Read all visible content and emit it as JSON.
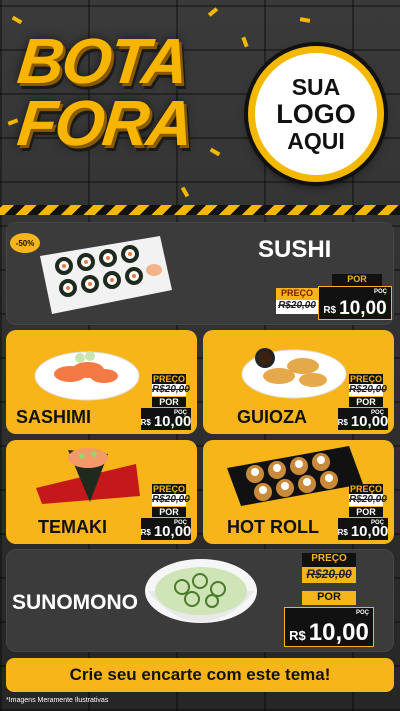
{
  "header": {
    "title_line_1": "BOTA",
    "title_line_2": "FORA",
    "logo_line_1": "SUA",
    "logo_line_2": "LOGO",
    "logo_line_3": "AQUI"
  },
  "products": [
    {
      "name": "SUSHI",
      "discount": "-50%",
      "preco_label": "PREÇO",
      "old_price": "R$20,00",
      "por_label": "POR",
      "currency": "R$",
      "price": "10,00",
      "unit": "POÇ"
    },
    {
      "name": "SASHIMI",
      "preco_label": "PREÇO",
      "old_price": "R$20,00",
      "por_label": "POR",
      "currency": "R$",
      "price": "10,00",
      "unit": "POÇ"
    },
    {
      "name": "GUIOZA",
      "preco_label": "PREÇO",
      "old_price": "R$20,00",
      "por_label": "POR",
      "currency": "R$",
      "price": "10,00",
      "unit": "POÇ"
    },
    {
      "name": "TEMAKI",
      "preco_label": "PREÇO",
      "old_price": "R$20,00",
      "por_label": "POR",
      "currency": "R$",
      "price": "10,00",
      "unit": "POÇ"
    },
    {
      "name": "HOT ROLL",
      "preco_label": "PREÇO",
      "old_price": "R$20,00",
      "por_label": "POR",
      "currency": "R$",
      "price": "10,00",
      "unit": "POÇ"
    },
    {
      "name": "SUNOMONO",
      "preco_label": "PREÇO",
      "old_price": "R$20,00",
      "por_label": "POR",
      "currency": "R$",
      "price": "10,00",
      "unit": "POÇ"
    }
  ],
  "footer": {
    "cta": "Crie seu encarte com este tema!",
    "disclaimer": "*Imagens Meramente Ilustrativas"
  },
  "colors": {
    "accent": "#f7b519",
    "dark_card": "#3b3b3b",
    "background": "#2b2b2b"
  }
}
